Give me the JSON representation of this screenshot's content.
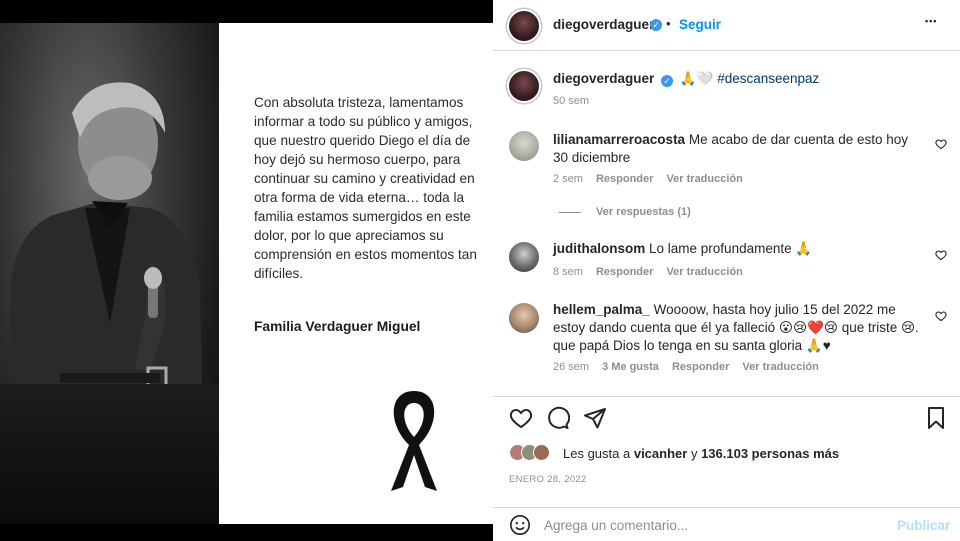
{
  "post": {
    "card_text": "Con absoluta tristeza, lamentamos informar a todo su público y amigos, que nuestro querido Diego el día de hoy dejó su hermoso cuerpo, para continuar su camino y creatividad en otra forma de vida eterna… toda la familia estamos sumergidos en este dolor, por lo que apreciamos su comprensión en estos momentos tan difíciles.",
    "card_signature": "Familia Verdaguer Miguel"
  },
  "header": {
    "username": "diegoverdaguer",
    "separator": "•",
    "follow_label": "Seguir",
    "more": "•••"
  },
  "caption": {
    "username": "diegoverdaguer",
    "emoji": "🙏🤍",
    "hashtag": "#descanseenpaz",
    "time": "50 sem"
  },
  "comments": [
    {
      "username": "lilianamarreroacosta",
      "text": "Me acabo de dar cuenta de esto hoy 30 diciembre",
      "time": "2 sem",
      "reply": "Responder",
      "translate": "Ver traducción",
      "view_replies": "Ver respuestas (1)"
    },
    {
      "username": "judithalonsom",
      "text": "Lo lame profundamente 🙏",
      "time": "8 sem",
      "reply": "Responder",
      "translate": "Ver traducción"
    },
    {
      "username": "hellem_palma_",
      "text": "Woooow, hasta hoy julio 15 del 2022 me estoy dando cuenta que él ya falleció 😮😢❤️😢 que triste 😢. que papá Dios lo tenga en su santa gloria 🙏♥",
      "time": "26 sem",
      "likes": "3 Me gusta",
      "reply": "Responder",
      "translate": "Ver traducción"
    }
  ],
  "likes": {
    "prefix": "Les gusta a",
    "user": "vicanher",
    "and": "y",
    "count": "136.103 personas más"
  },
  "date": "ENERO 28, 2022",
  "add_comment": {
    "placeholder": "Agrega un comentario...",
    "publish": "Publicar"
  },
  "colors": {
    "link": "#0095f6",
    "verified": "#3897f0",
    "muted": "#8e8e8e",
    "text": "#262626"
  }
}
